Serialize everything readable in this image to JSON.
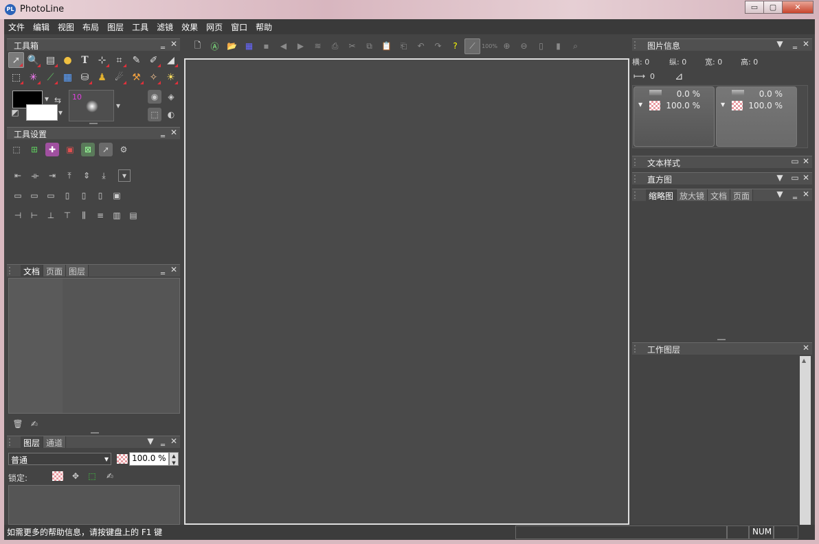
{
  "window": {
    "title": "PhotoLine",
    "app_icon": "PL",
    "buttons": [
      "▭",
      "▢",
      "✕"
    ]
  },
  "menu": [
    "文件",
    "编辑",
    "视图",
    "布局",
    "图层",
    "工具",
    "滤镜",
    "效果",
    "网页",
    "窗口",
    "帮助"
  ],
  "toolbox": {
    "title": "工具箱",
    "brush_size": "10"
  },
  "tool_settings": {
    "title": "工具设置"
  },
  "doc_panel": {
    "tabs": [
      "文档",
      "页面",
      "图层"
    ]
  },
  "layers_panel": {
    "tabs": [
      "图层",
      "通道"
    ],
    "blend_mode": "普通",
    "opacity": "100.0 %",
    "lock_label": "锁定:"
  },
  "toolbar": {
    "zoom_label": "100%"
  },
  "image_info": {
    "title": "图片信息",
    "horiz": "横: 0",
    "vert": "纵: 0",
    "width": "宽: 0",
    "height": "高: 0",
    "distance": "0",
    "card1": {
      "top_pct": "0.0 %",
      "bottom_pct": "100.0 %"
    },
    "card2": {
      "top_pct": "0.0 %",
      "bottom_pct": "100.0 %"
    }
  },
  "text_style": {
    "title": "文本样式"
  },
  "histogram": {
    "title": "直方图"
  },
  "navigator": {
    "tabs": [
      "缩略图",
      "放大镜",
      "文档",
      "页面"
    ]
  },
  "work_layers": {
    "title": "工作图层"
  },
  "status": {
    "help": "如需更多的帮助信息，请按键盘上的 F1 键",
    "num": "NUM"
  }
}
